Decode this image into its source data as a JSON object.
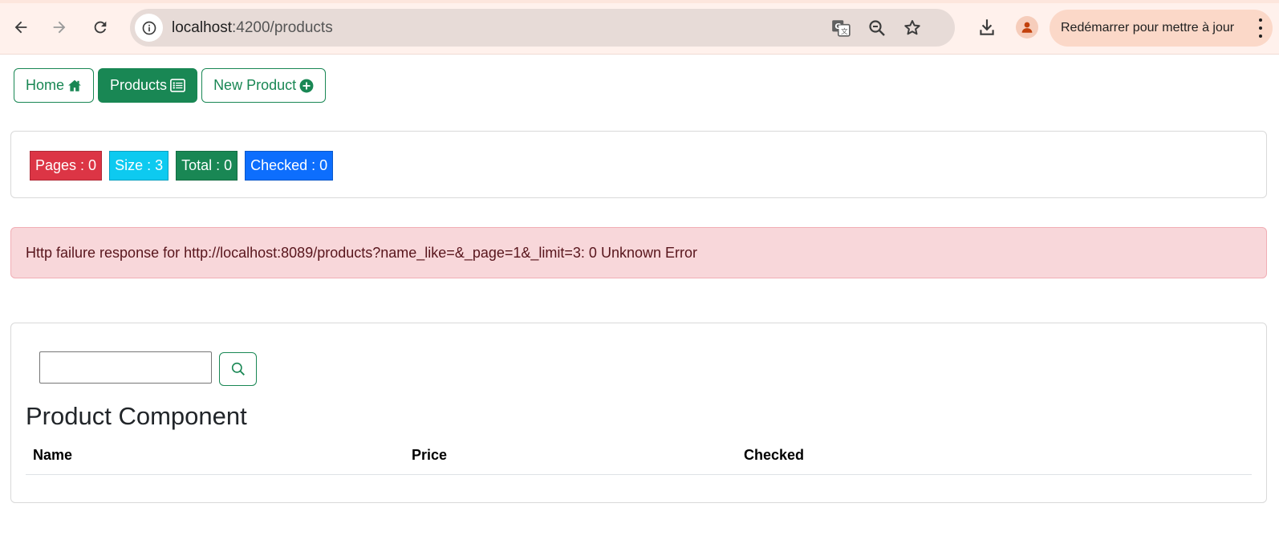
{
  "browser": {
    "url_host": "localhost",
    "url_rest": ":4200/products",
    "update_label": "Redémarrer pour mettre à jour"
  },
  "nav": {
    "home": "Home",
    "products": "Products",
    "new_product": "New Product"
  },
  "stats": {
    "pages": "Pages : 0",
    "size": "Size : 3",
    "total": "Total : 0",
    "checked": "Checked : 0"
  },
  "colors": {
    "primary_green": "#198754",
    "danger": "#dc3545",
    "info": "#0dcaf0",
    "primary_blue": "#0d6efd",
    "alert_bg": "#f8d7da"
  },
  "alert": {
    "message": "Http failure response for http://localhost:8089/products?name_like=&_page=1&_limit=3: 0 Unknown Error"
  },
  "products": {
    "search_value": "",
    "title": "Product Component",
    "columns": [
      "Name",
      "Price",
      "Checked"
    ]
  },
  "icons": {
    "back": "arrow-left-icon",
    "forward": "arrow-right-icon",
    "reload": "reload-icon",
    "info": "info-icon",
    "translate": "translate-icon",
    "zoom": "zoom-out-icon",
    "bookmark": "star-icon",
    "download": "download-icon",
    "profile": "avatar-icon",
    "menu": "kebab-menu-icon",
    "home": "house-icon",
    "products": "card-list-icon",
    "new_product": "plus-circle-icon",
    "search": "search-icon"
  }
}
